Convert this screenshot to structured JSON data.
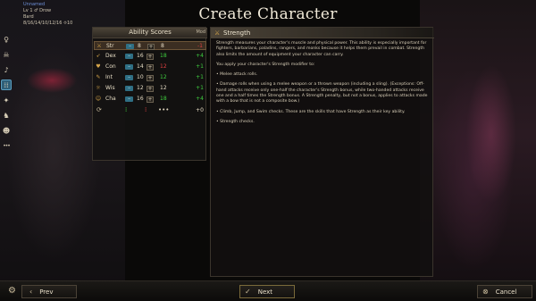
{
  "header": {
    "character_name": "Unnamed",
    "race_line": "Lv 1 ♂ Drow",
    "class_line": "Bard",
    "stats_line": "8/16/14/10/12/16 ⯑10"
  },
  "title": "Create Character",
  "sidebar": {
    "steps": [
      {
        "icon": "♀",
        "name": "gender-step-icon"
      },
      {
        "icon": "☠",
        "name": "race-step-icon"
      },
      {
        "icon": "♪",
        "name": "class-step-icon"
      },
      {
        "icon": "⁞⁞",
        "name": "abilities-step-icon",
        "active": true
      },
      {
        "icon": "✦",
        "name": "skills-step-icon"
      },
      {
        "icon": "♞",
        "name": "feats-step-icon"
      },
      {
        "icon": "☻",
        "name": "appearance-step-icon"
      },
      {
        "icon": "•••",
        "name": "more-steps-icon"
      }
    ]
  },
  "ability_panel": {
    "title": "Ability Scores",
    "mod_header": "Mod",
    "rows": [
      {
        "icon": "⚔",
        "name": "Str",
        "base": "8",
        "final": "8",
        "mod": "-1",
        "mod_class": "neg",
        "final_class": "neu",
        "selected": true
      },
      {
        "icon": "➶",
        "name": "Dex",
        "base": "16",
        "final": "18",
        "mod": "+4",
        "mod_class": "pos",
        "final_class": "pos"
      },
      {
        "icon": "♥",
        "name": "Con",
        "base": "14",
        "final": "12",
        "mod": "+1",
        "mod_class": "pos",
        "final_class": "neg"
      },
      {
        "icon": "✎",
        "name": "Int",
        "base": "10",
        "final": "12",
        "mod": "+1",
        "mod_class": "pos",
        "final_class": "pos"
      },
      {
        "icon": "☼",
        "name": "Wis",
        "base": "12",
        "final": "12",
        "mod": "+1",
        "mod_class": "pos",
        "final_class": "neu"
      },
      {
        "icon": "☺",
        "name": "Cha",
        "base": "16",
        "final": "18",
        "mod": "+4",
        "mod_class": "pos",
        "final_class": "pos"
      }
    ],
    "footer": {
      "total_mod": "+0"
    }
  },
  "description": {
    "title": "Strength",
    "paragraphs": [
      "Strength measures your character's muscle and physical power. This ability is especially important for fighters, barbarians, paladins, rangers, and monks because it helps them prevail in combat. Strength also limits the amount of equipment your character can carry.",
      "You apply your character's Strength modifier to:",
      "• Melee attack rolls.",
      "• Damage rolls when using a melee weapon or a thrown weapon (including a sling). (Exceptions: Off-hand attacks receive only one-half the character's Strength bonus, while two-handed attacks receive one and a half times the Strength bonus. A Strength penalty, but not a bonus, applies to attacks made with a bow that is not a composite bow.)",
      "• Climb, Jump, and Swim checks. These are the skills that have Strength as their key ability.",
      "• Strength checks."
    ]
  },
  "bottom_bar": {
    "prev_label": "Prev",
    "next_label": "Next",
    "cancel_label": "Cancel"
  }
}
